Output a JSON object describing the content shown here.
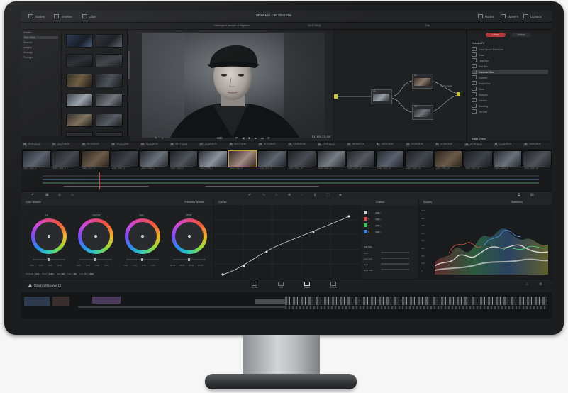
{
  "menubar": {
    "items": [
      {
        "label": "Gallery",
        "icon": "gallery-icon"
      },
      {
        "label": "Timeline",
        "icon": "timeline-icon"
      },
      {
        "label": "Clips",
        "icon": "clips-icon"
      }
    ],
    "project_title": "URSA Mini 4.6K Short Film",
    "right": [
      {
        "label": "Nodes",
        "icon": "nodes-icon"
      },
      {
        "label": "OpenFX",
        "icon": "openfx-icon"
      },
      {
        "label": "Lightbox",
        "icon": "lightbox-icon"
      }
    ]
  },
  "viewer_bar": {
    "clip_name": "Harbinger's sample of Mayhem",
    "timecode": "12:47:00:11",
    "mode": "Clip"
  },
  "media_tree": {
    "items": [
      "Master",
      "Sub Clips",
      "Shared",
      "Images",
      "Analogs",
      "Footage"
    ],
    "selected_index": 1
  },
  "viewer": {
    "timecode": "01:00:23:04",
    "zoom": "100"
  },
  "nodes": {
    "items": [
      {
        "label": "01"
      },
      {
        "label": "02"
      },
      {
        "label": "03"
      }
    ],
    "output_label": "Output Node"
  },
  "right_panel": {
    "tabs": [
      "Library",
      "Settings"
    ],
    "active_tab": "Library",
    "section1": "ResolveFX",
    "items": [
      "Color Space Transform",
      "Grain",
      "Lens Blur",
      "Mist Blur",
      "Gaussian Blur",
      "Vignette",
      "Radial Blur",
      "Glow",
      "Sharpen",
      "Halation",
      "Blanking",
      "Tilt-Shift"
    ],
    "selected_index": 4,
    "section2": "Basic Video",
    "section2_items": [
      "Global Lighting"
    ]
  },
  "clips": [
    {
      "num": "01",
      "tc": "05:01:20:13",
      "name": "A001_C002_1"
    },
    {
      "num": "02",
      "tc": "02:27:06:15",
      "name": "A001_C004_2"
    },
    {
      "num": "03",
      "tc": "09:12:04:22",
      "name": "A001_C007_3"
    },
    {
      "num": "04",
      "tc": "10:12:23:05",
      "name": "A002_C001_4"
    },
    {
      "num": "05",
      "tc": "08:03:20:03",
      "name": "A002_C008_5"
    },
    {
      "num": "06",
      "tc": "09:17:33:03",
      "name": "A003_C002_6"
    },
    {
      "num": "07",
      "tc": "22:05:44:21",
      "name": "A003_C006_7"
    },
    {
      "num": "08",
      "tc": "00:17:14:16",
      "name": "A004_C001_8"
    },
    {
      "num": "09",
      "tc": "01:04:06:01",
      "name": "A004_C004_9"
    },
    {
      "num": "10",
      "tc": "03:30:06:08",
      "name": "A005_C001_10"
    },
    {
      "num": "11",
      "tc": "12:05:24:12",
      "name": "A005_C003_11"
    },
    {
      "num": "12",
      "tc": "09:08:07:14",
      "name": "A006_C002_12"
    },
    {
      "num": "13",
      "tc": "08:05:33:12",
      "name": "A006_C005_13"
    },
    {
      "num": "14",
      "tc": "13:39:03:05",
      "name": "A007_C001_14"
    },
    {
      "num": "15",
      "tc": "11:06:14:20",
      "name": "A007_C004_15"
    },
    {
      "num": "16",
      "tc": "22:16:04:12",
      "name": "A008_C001_16"
    },
    {
      "num": "17",
      "tc": "21:02:25:15",
      "name": "A008_C003_17"
    },
    {
      "num": "18",
      "tc": "23:00:26:09",
      "name": "A009_C002_18"
    }
  ],
  "selected_clip": 7,
  "panels": {
    "wheels_title": "Color Wheels",
    "wheels_mode": "Primaries Wheels",
    "curves_title": "Curves",
    "curves_mode": "Custom",
    "scopes_title": "Scopes",
    "scopes_mode": "Waveform"
  },
  "wheels": [
    {
      "label": "Lift",
      "values": [
        "0.00",
        "0.00",
        "0.00",
        "0.00"
      ]
    },
    {
      "label": "Gamma",
      "values": [
        "0.00",
        "0.00",
        "0.00",
        "0.00"
      ]
    },
    {
      "label": "Gain",
      "values": [
        "1.00",
        "1.00",
        "1.00",
        "1.00"
      ]
    },
    {
      "label": "Offset",
      "values": [
        "25.00",
        "25.00",
        "25.00",
        "25.00"
      ]
    }
  ],
  "primary_params": [
    {
      "label": "Contrast",
      "value": "1.0"
    },
    {
      "label": "Pivot",
      "value": "0.43"
    },
    {
      "label": "Sat",
      "value": "50"
    },
    {
      "label": "Hue",
      "value": "50"
    },
    {
      "label": "Lum Mix",
      "value": "100"
    }
  ],
  "curve_channels": [
    {
      "label": "Y",
      "value": "100",
      "color": "#cfd2d5"
    },
    {
      "label": "R",
      "value": "100",
      "color": "#d94a4a"
    },
    {
      "label": "G",
      "value": "100",
      "color": "#3fbf5a"
    },
    {
      "label": "B",
      "value": "100",
      "color": "#3f7fe0"
    }
  ],
  "soft_clip": {
    "title": "Soft Clip",
    "rows": [
      "Low",
      "Low Soft",
      "High",
      "High Soft"
    ]
  },
  "waveform_scale": [
    "1023",
    "896",
    "768",
    "640",
    "512",
    "384",
    "256",
    "128",
    "0"
  ],
  "bottom": {
    "brand": "DaVinci Resolve 12",
    "pages": [
      "Media",
      "Edit",
      "Color",
      "Deliver"
    ],
    "active_page": "Color"
  },
  "colors": {
    "accent": "#c9a13a",
    "wheel_ring": "rainbow",
    "background": "#191a1c"
  }
}
